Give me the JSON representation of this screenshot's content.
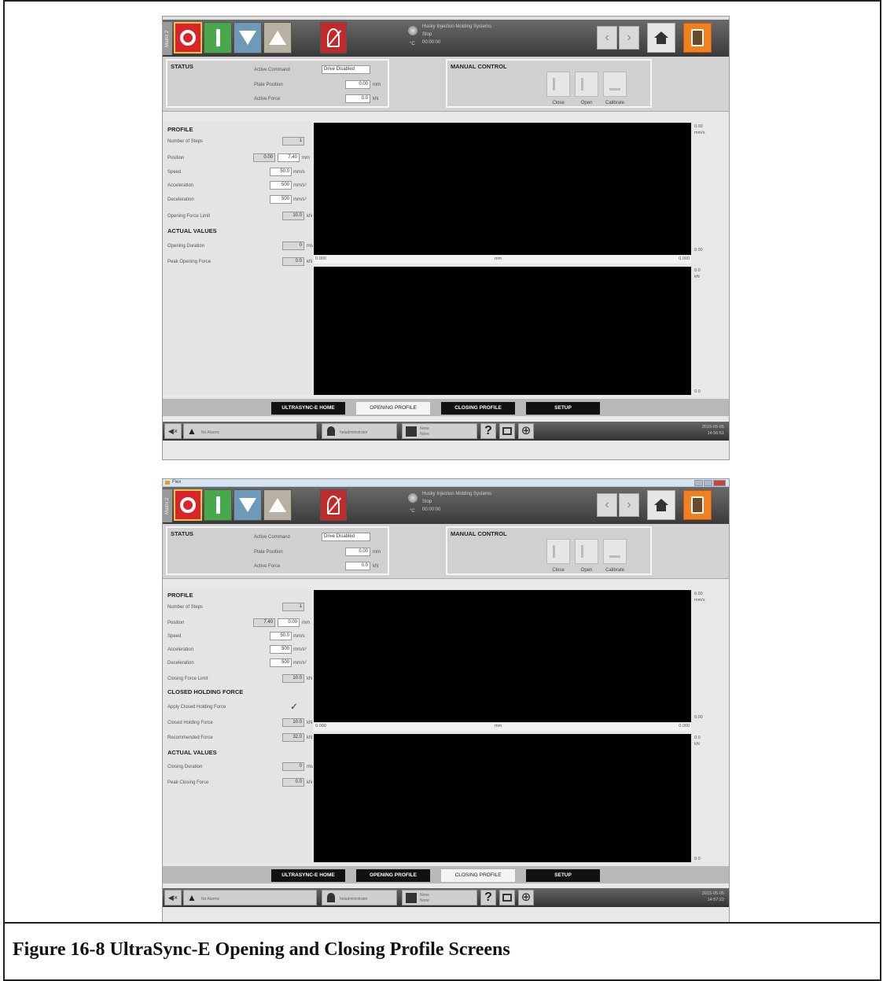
{
  "caption": "Figure 16-8 UltraSync-E Opening and Closing Profile Screens",
  "screens": [
    {
      "window_title": "",
      "matrix_tab": "Matrix 2",
      "machine": {
        "name": "Husky Injection Molding Systems",
        "state": "Stop",
        "time": "00:00:00",
        "temp_unit": "°C"
      },
      "status": {
        "title": "STATUS",
        "active_command_label": "Active Command",
        "active_command": "Drive Disabled",
        "plate_position_label": "Plate Position",
        "plate_position": "0.00",
        "plate_unit": "mm",
        "active_force_label": "Active Force",
        "active_force": "0.0",
        "force_unit": "kN"
      },
      "manual": {
        "title": "MANUAL CONTROL",
        "close": "Close",
        "open": "Open",
        "calibrate": "Calibrate"
      },
      "profile": {
        "title": "PROFILE",
        "steps_label": "Number of Steps",
        "steps": "1",
        "position_label": "Position",
        "position_from": "0.00",
        "position_to": "7.40",
        "position_unit": "mm",
        "speed_label": "Speed",
        "speed": "50.0",
        "speed_unit": "mm/s",
        "accel_label": "Acceleration",
        "accel": "500",
        "accel_unit": "mm/s²",
        "decel_label": "Deceleration",
        "decel": "500",
        "decel_unit": "mm/s²",
        "force_limit_label": "Opening Force Limit",
        "force_limit": "10.0",
        "force_limit_unit": "kN"
      },
      "actual": {
        "title": "ACTUAL VALUES",
        "duration_label": "Opening Duration",
        "duration": "0",
        "duration_unit": "ms",
        "peak_label": "Peak Opening Force",
        "peak": "0.0",
        "peak_unit": "kN"
      },
      "chart1": {
        "ytop": "0.00",
        "yunit": "mm/s",
        "ybot": "0.00",
        "xleft": "0.000",
        "xunit": "mm",
        "xright": "0.000"
      },
      "chart2": {
        "ytop": "0.0",
        "yunit": "kN",
        "ybot": "0.0"
      },
      "tabs": [
        "ULTRASYNC-E HOME",
        "OPENING PROFILE",
        "CLOSING PROFILE",
        "SETUP"
      ],
      "bottom": {
        "alarms": "No Alarms",
        "user": "heiadministrator",
        "mold_line1": "None",
        "mold_line2": "None",
        "help": "?",
        "date": "2015-05-05",
        "time": "14:56:51"
      }
    },
    {
      "window_title": "Flex",
      "matrix_tab": "Matrix 2",
      "machine": {
        "name": "Husky Injection Molding Systems",
        "state": "Stop",
        "time": "00:00:00",
        "temp_unit": "°C"
      },
      "status": {
        "title": "STATUS",
        "active_command_label": "Active Command",
        "active_command": "Drive Disabled",
        "plate_position_label": "Plate Position",
        "plate_position": "0.00",
        "plate_unit": "mm",
        "active_force_label": "Active Force",
        "active_force": "0.0",
        "force_unit": "kN"
      },
      "manual": {
        "title": "MANUAL CONTROL",
        "close": "Close",
        "open": "Open",
        "calibrate": "Calibrate"
      },
      "profile": {
        "title": "PROFILE",
        "steps_label": "Number of Steps",
        "steps": "1",
        "position_label": "Position",
        "position_from": "7.40",
        "position_to": "0.00",
        "position_unit": "mm",
        "speed_label": "Speed",
        "speed": "50.0",
        "speed_unit": "mm/s",
        "accel_label": "Acceleration",
        "accel": "500",
        "accel_unit": "mm/s²",
        "decel_label": "Deceleration",
        "decel": "500",
        "decel_unit": "mm/s²",
        "force_limit_label": "Closing Force Limit",
        "force_limit": "10.0",
        "force_limit_unit": "kN"
      },
      "holding": {
        "title": "CLOSED HOLDING FORCE",
        "apply_label": "Apply Closed Holding Force",
        "apply_check": "✓",
        "hold_label": "Closed Holding Force",
        "hold": "10.0",
        "hold_unit": "kN",
        "rec_label": "Recommended Force",
        "rec": "32.0",
        "rec_unit": "kN"
      },
      "actual": {
        "title": "ACTUAL VALUES",
        "duration_label": "Closing Duration",
        "duration": "0",
        "duration_unit": "ms",
        "peak_label": "Peak Closing Force",
        "peak": "0.0",
        "peak_unit": "kN"
      },
      "chart1": {
        "ytop": "0.00",
        "yunit": "mm/s",
        "ybot": "0.00",
        "xleft": "0.000",
        "xunit": "mm",
        "xright": "0.000"
      },
      "chart2": {
        "ytop": "0.0",
        "yunit": "kN",
        "ybot": "0.0"
      },
      "tabs": [
        "ULTRASYNC-E HOME",
        "OPENING PROFILE",
        "CLOSING PROFILE",
        "SETUP"
      ],
      "bottom": {
        "alarms": "No Alarms",
        "user": "heiadministrator",
        "mold_line1": "None",
        "mold_line2": "None",
        "help": "?",
        "date": "2015-05-05",
        "time": "14:57:22"
      }
    }
  ]
}
